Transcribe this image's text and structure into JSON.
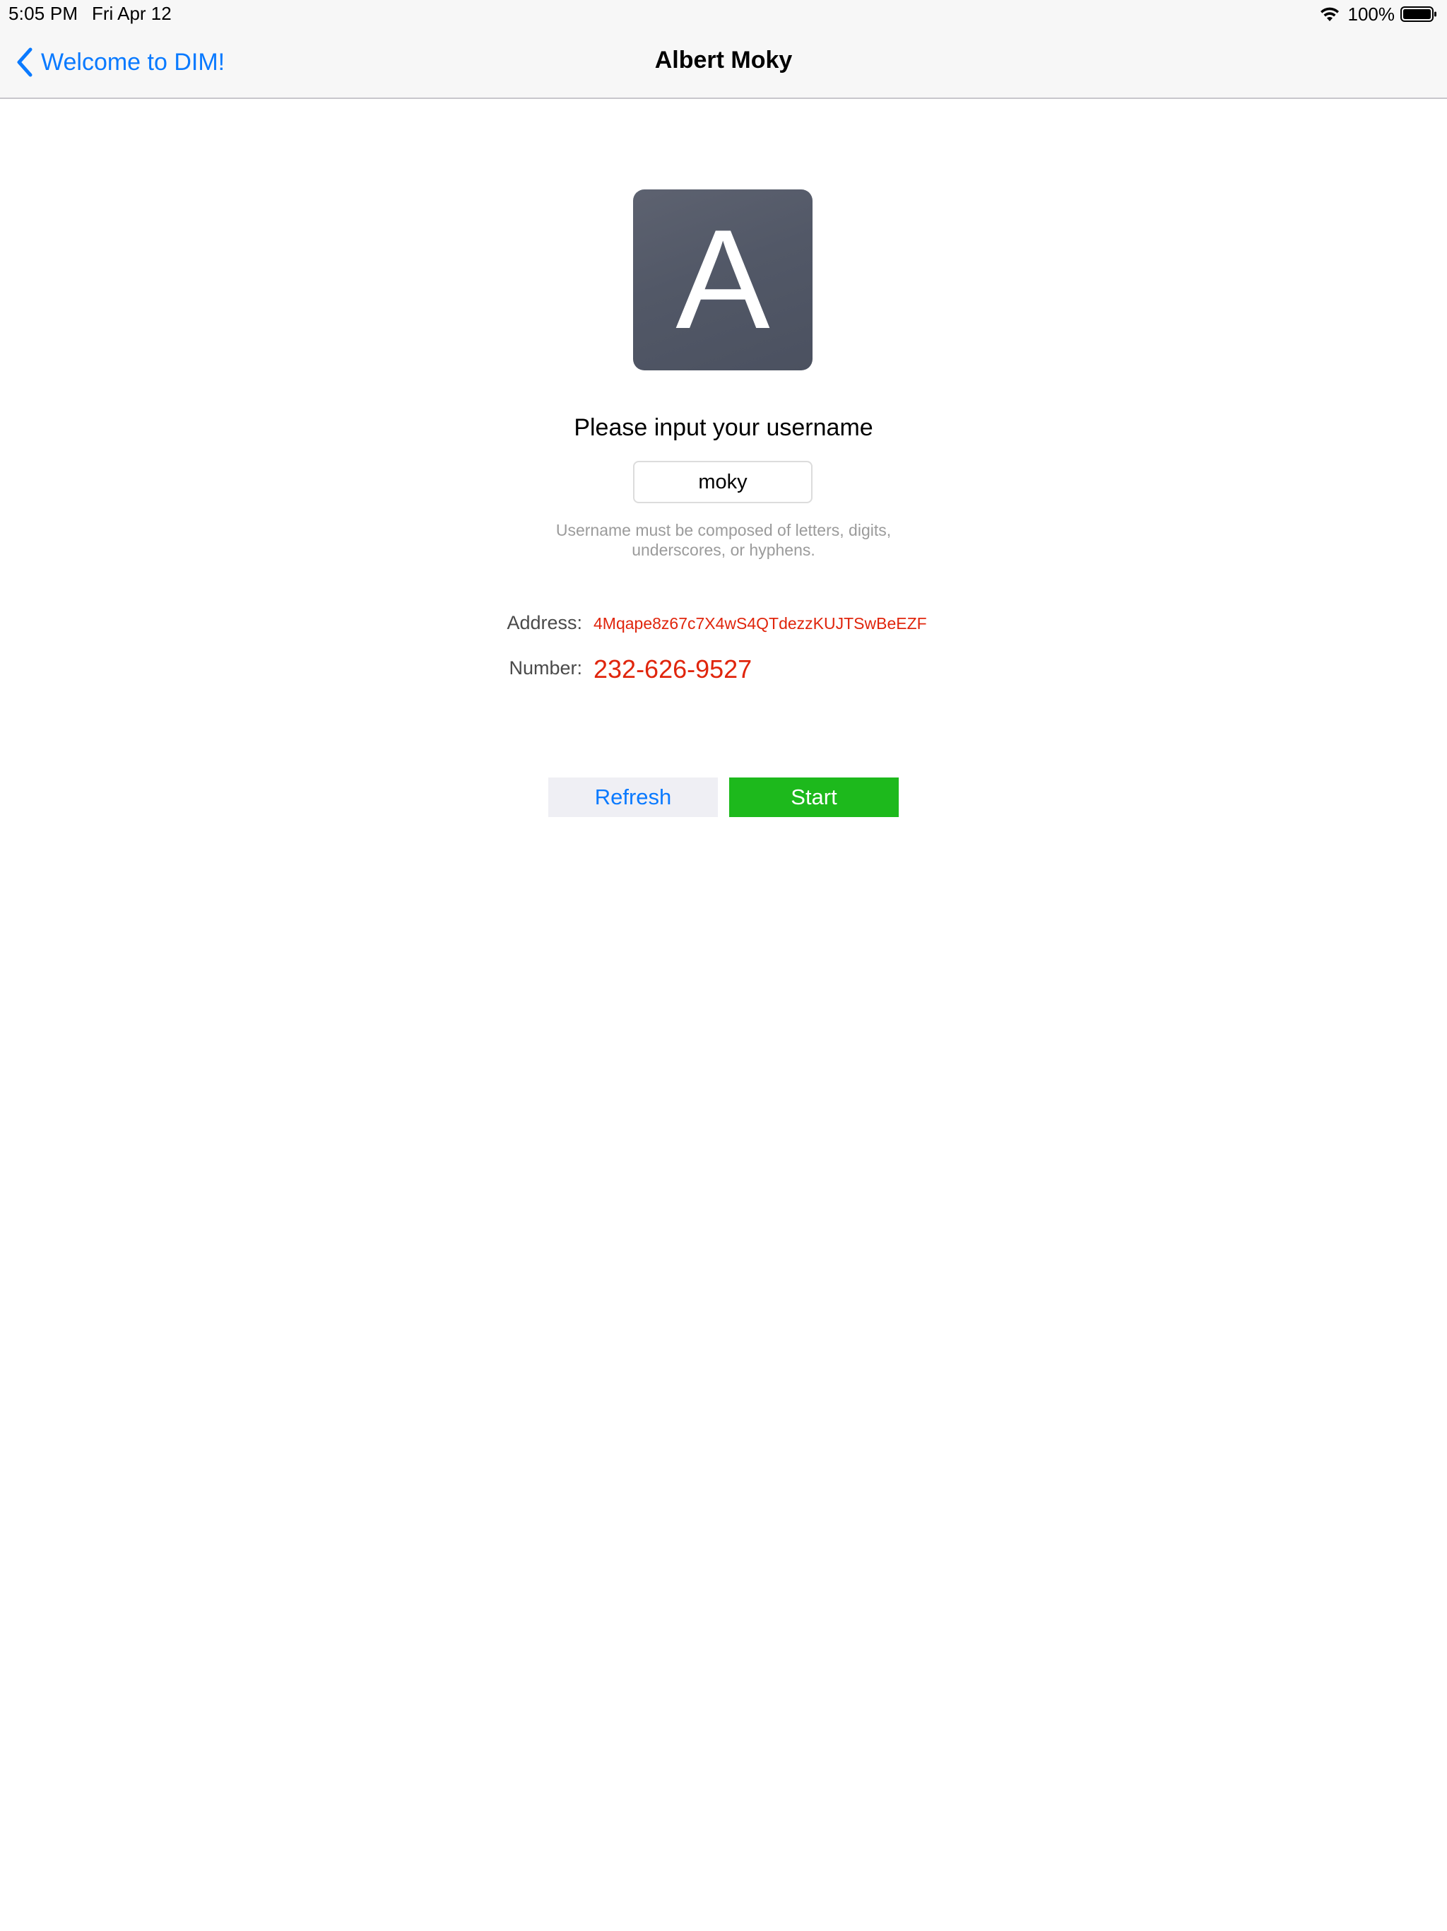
{
  "status_bar": {
    "time": "5:05 PM",
    "date": "Fri Apr 12",
    "battery": "100%",
    "icons": [
      "wifi-icon",
      "battery-icon"
    ]
  },
  "nav": {
    "back_label": "Welcome to DIM!",
    "title": "Albert Moky",
    "back_icon": "chevron-left-icon"
  },
  "avatar": {
    "letter": "A"
  },
  "form": {
    "prompt": "Please input your username",
    "username_value": "moky",
    "hint_line1": "Username must be composed of letters, digits,",
    "hint_line2": "underscores, or hyphens."
  },
  "info": {
    "address_label": "Address:",
    "address_value": "4Mqape8z67c7X4wS4QTdezzKUJTSwBeEZF",
    "number_label": "Number:",
    "number_value": "232-626-9527"
  },
  "actions": {
    "refresh_label": "Refresh",
    "start_label": "Start"
  },
  "colors": {
    "accent_blue": "#0a7aff",
    "value_red": "#e0250c",
    "start_green": "#1db91c",
    "avatar_bg": "#555a68"
  }
}
